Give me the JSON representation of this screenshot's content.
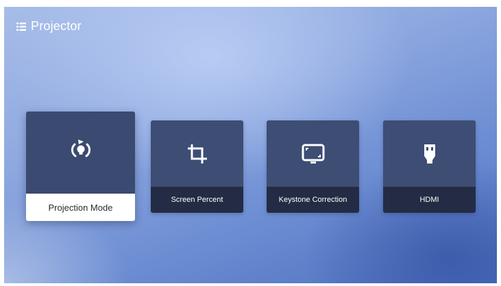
{
  "header": {
    "title": "Projector",
    "icon": "menu-list-icon"
  },
  "tiles": [
    {
      "label": "Projection Mode",
      "icon": "projection-mode-icon",
      "selected": true
    },
    {
      "label": "Screen Percent",
      "icon": "crop-icon",
      "selected": false
    },
    {
      "label": "Keystone Correction",
      "icon": "keystone-icon",
      "selected": false
    },
    {
      "label": "HDMI",
      "icon": "hdmi-icon",
      "selected": false
    }
  ],
  "colors": {
    "tile": "#3d4d74",
    "label_bar": "#232c44",
    "selected_label_bar": "#ffffff"
  }
}
